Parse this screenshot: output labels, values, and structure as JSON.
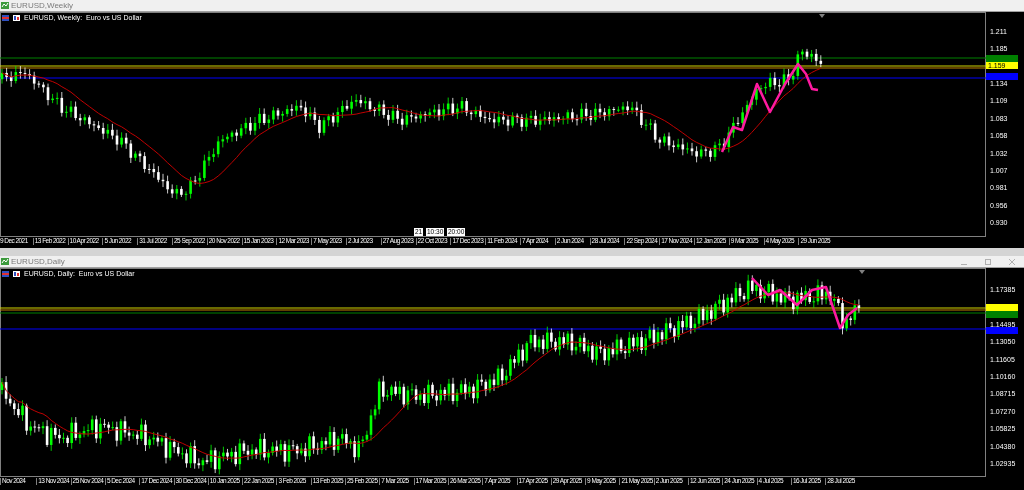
{
  "windows": [
    {
      "title": "EURUSD,Weekly",
      "window_buttons": false,
      "chart_label": "EURUSD, Weekly:  Euro vs US Dollar",
      "price_scale": [
        "1.211",
        "1.185",
        "1.134",
        "1.109",
        "1.083",
        "1.058",
        "1.032",
        "1.007",
        "0.981",
        "0.956",
        "0.930"
      ],
      "current_price": "1.159",
      "crosshair_labels": [
        "21",
        "10:30",
        "20:00"
      ],
      "time_scale": [
        "9 Dec 2021",
        "13 Feb 2022",
        "10 Apr 2022",
        "5 Jun 2022",
        "31 Jul 2022",
        "25 Sep 2022",
        "20 Nov 2022",
        "15 Jan 2023",
        "12 Mar 2023",
        "7 May 2023",
        "2 Jul 2023",
        "27 Aug 2023",
        "22 Oct 2023",
        "17 Dec 2023",
        "11 Feb 2024",
        "7 Apr 2024",
        "2 Jun 2024",
        "28 Jul 2024",
        "22 Sep 2024",
        "17 Nov 2024",
        "12 Jan 2025",
        "9 Mar 2025",
        "4 May 2025",
        "29 Jun 2025"
      ]
    },
    {
      "title": "EURUSD,Daily",
      "window_buttons": true,
      "chart_label": "EURUSD, Daily:  Euro vs US Dollar",
      "price_scale": [
        "1.17385",
        "1.14495",
        "1.13050",
        "1.11605",
        "1.10160",
        "1.08715",
        "1.07270",
        "1.05825",
        "1.04380",
        "1.02935"
      ],
      "time_scale": [
        "Nov 2024",
        "13 Nov 2024",
        "25 Nov 2024",
        "5 Dec 2024",
        "17 Dec 2024",
        "30 Dec 2024",
        "10 Jan 2025",
        "22 Jan 2025",
        "3 Feb 2025",
        "13 Feb 2025",
        "25 Feb 2025",
        "7 Mar 2025",
        "17 Mar 2025",
        "26 Mar 2025",
        "7 Apr 2025",
        "17 Apr 2025",
        "29 Apr 2025",
        "9 May 2025",
        "21 May 2025",
        "2 Jun 2025",
        "12 Jun 2025",
        "24 Jun 2025",
        "4 Jul 2025",
        "16 Jul 2025",
        "28 Jul 2025"
      ]
    }
  ]
}
